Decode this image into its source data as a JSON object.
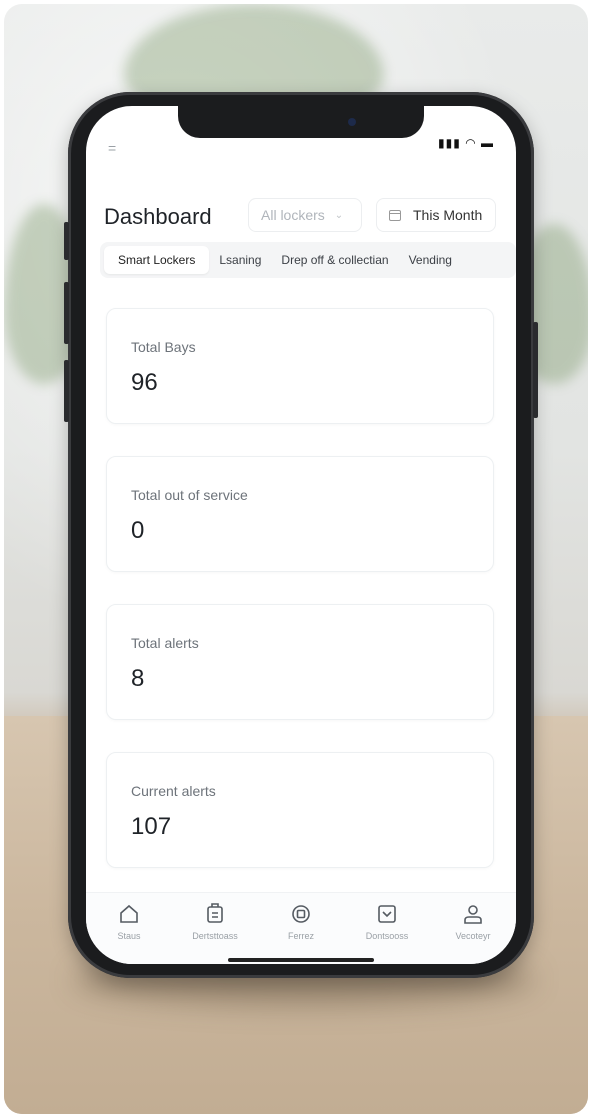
{
  "status": {
    "menu_glyph": "=",
    "indicators": "▮▮▮ ◠ ▬"
  },
  "header": {
    "title": "Dashboard",
    "lockers_filter": "All lockers",
    "date_filter": "This Month"
  },
  "tabs": [
    {
      "label": "Smart Lockers",
      "active": true
    },
    {
      "label": "Lsaning"
    },
    {
      "label": "Drep off & collectian"
    },
    {
      "label": "Vending"
    }
  ],
  "cards": [
    {
      "label": "Total Bays",
      "value": "96"
    },
    {
      "label": "Total out of service",
      "value": "0"
    },
    {
      "label": "Total alerts",
      "value": "8"
    },
    {
      "label": "Current alerts",
      "value": "107"
    }
  ],
  "bottom_nav": [
    {
      "label": "Staus",
      "icon": "home-icon"
    },
    {
      "label": "Dertsttoass",
      "icon": "parcel-icon"
    },
    {
      "label": "Ferrez",
      "icon": "box-icon"
    },
    {
      "label": "Dontsooss",
      "icon": "inbox-icon"
    },
    {
      "label": "Vecoteyr",
      "icon": "user-icon"
    }
  ],
  "colors": {
    "text_primary": "#1f2328",
    "text_secondary": "#6d737a",
    "card_border": "#edf0f2"
  }
}
